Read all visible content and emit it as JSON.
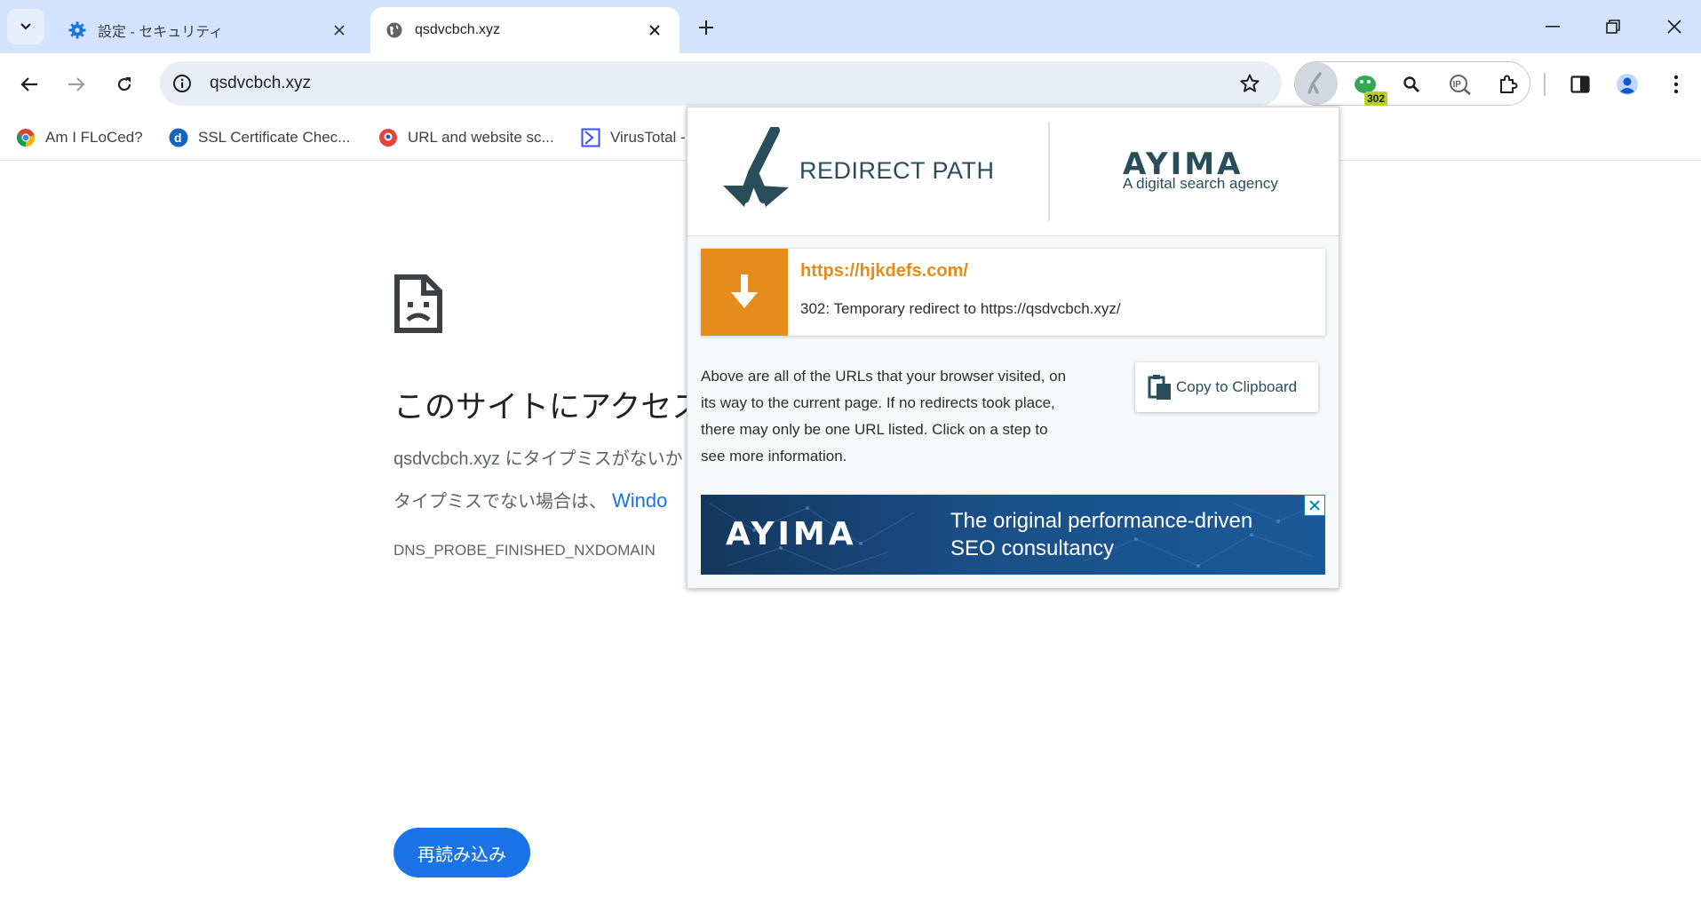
{
  "browser": {
    "tabs": [
      {
        "title": "設定 - セキュリティ",
        "icon": "gear-icon",
        "active": false
      },
      {
        "title": "qsdvcbch.xyz",
        "icon": "globe-icon",
        "active": true
      }
    ],
    "address_bar": {
      "url": "qsdvcbch.xyz"
    },
    "extensions": {
      "redirect_badge": "302"
    },
    "bookmarks": [
      {
        "label": "Am I FLoCed?",
        "icon": "chrome-icon"
      },
      {
        "label": "SSL Certificate Chec...",
        "icon": "d-logo-icon"
      },
      {
        "label": "URL and website sc...",
        "icon": "urlscan-icon"
      },
      {
        "label": "VirusTotal -",
        "icon": "virustotal-icon"
      }
    ]
  },
  "error_page": {
    "title": "このサイトにアクセス",
    "line1": "qsdvcbch.xyz にタイプミスがないか",
    "line2": "タイプミスでない場合は、",
    "line2_link": "Windo",
    "error_code": "DNS_PROBE_FINISHED_NXDOMAIN",
    "reload_label": "再読み込み"
  },
  "redirect_popup": {
    "brand": "REDIRECT PATH",
    "agency_logo": "AYIMA",
    "agency_tagline": "A digital search agency",
    "step": {
      "url": "https://hjkdefs.com/",
      "description": "302: Temporary redirect to https://qsdvcbch.xyz/"
    },
    "info_text": "Above are all of the URLs that your browser visited, on its way to the current page. If no redirects took place, there may only be one URL listed. Click on a step to see more information.",
    "copy_label": "Copy to Clipboard",
    "ad": {
      "logo": "AYIMA",
      "line1": "The original performance-driven",
      "line2": "SEO consultancy"
    }
  },
  "colors": {
    "tabstrip_bg": "#d3e3fd",
    "accent_orange": "#e58c1b",
    "brand_dark": "#2a4d5c",
    "link_blue": "#1a73e8"
  }
}
